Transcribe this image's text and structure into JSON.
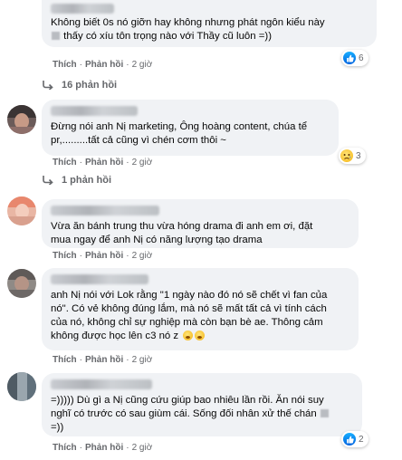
{
  "comments": [
    {
      "author": "",
      "lines": [
        "Không biết 0s nó giỡn hay không nhưng phát ngôn kiểu này",
        "thấy có xíu tôn trọng nào với Thầy cũ luôn =))"
      ],
      "like": "Thích",
      "reply": "Phản hồi",
      "time": "2 giờ",
      "reaction": {
        "icon": "like-icon",
        "count": "6"
      },
      "replies": "16 phản hồi"
    },
    {
      "author": "",
      "lines": [
        "Đừng nói anh Nị marketing, Ông hoàng content, chúa tể",
        "pr,.........tất cả cũng vì chén cơm thôi ~"
      ],
      "like": "Thích",
      "reply": "Phản hồi",
      "time": "2 giờ",
      "reaction": {
        "icon": "sad-icon",
        "count": "3"
      },
      "replies": "1 phản hồi"
    },
    {
      "author": "",
      "lines": [
        "Vừa ăn bánh trung thu vừa hóng drama đi anh em ơi, đặt",
        "mua ngay để anh Nị có năng lượng tạo drama"
      ],
      "like": "Thích",
      "reply": "Phản hồi",
      "time": "2 giờ"
    },
    {
      "author": "",
      "lines": [
        "anh Nị nói với Lok rằng \"1 ngày nào đó nó sẽ chết vì fan của",
        "nó\". Có vẻ không đúng lắm, mà nó sẽ mất tất cả vì tính cách",
        "của nó, không chỉ sự nghiệp mà còn bạn bè ae. Thông cảm",
        "không được học lên c3 nó z"
      ],
      "like": "Thích",
      "reply": "Phản hồi",
      "time": "2 giờ"
    },
    {
      "author": "",
      "lines": [
        "=))))) Dù gì a Nị cũng cứu giúp bao nhiêu lần rồi. Ăn nói suy",
        "nghĩ có trước có sau giùm cái. Sống đối nhân xử thế chán",
        "=))"
      ],
      "like": "Thích",
      "reply": "Phản hồi",
      "time": "2 giờ",
      "reaction": {
        "icon": "like-icon",
        "count": "2"
      }
    }
  ],
  "colors": {
    "bubble": "#f0f2f5",
    "meta": "#65676b",
    "like_blue": "#1877f2"
  }
}
